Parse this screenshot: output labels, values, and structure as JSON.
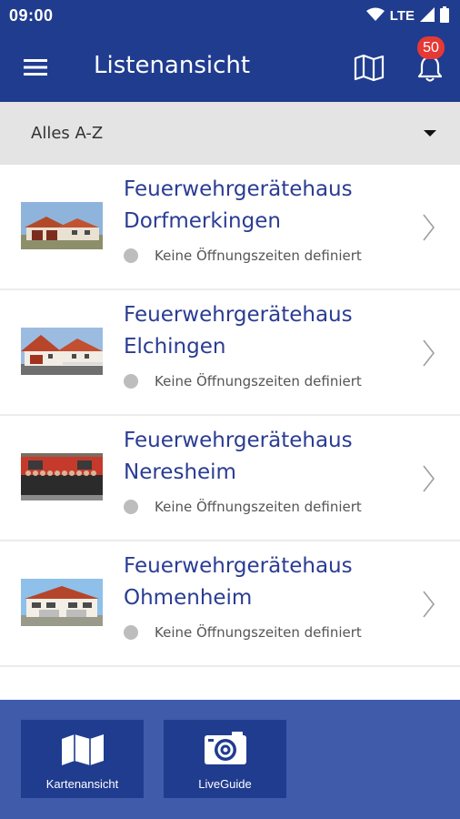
{
  "statusbar": {
    "time": "09:00",
    "network": "LTE",
    "icons": [
      "wifi-icon",
      "signal-icon",
      "battery-icon"
    ]
  },
  "appbar": {
    "title": "Listenansicht",
    "notification_count": "50",
    "icons": [
      "menu-icon",
      "map-icon",
      "bell-icon"
    ]
  },
  "sort": {
    "label": "Alles A-Z"
  },
  "list": {
    "items": [
      {
        "title_line1": "Feuerwehrgerätehaus",
        "title_line2": "Dorfmerkingen",
        "status": "Keine Öffnungszeiten definiert"
      },
      {
        "title_line1": "Feuerwehrgerätehaus",
        "title_line2": "Elchingen",
        "status": "Keine Öffnungszeiten definiert"
      },
      {
        "title_line1": "Feuerwehrgerätehaus",
        "title_line2": "Neresheim",
        "status": "Keine Öffnungszeiten definiert"
      },
      {
        "title_line1": "Feuerwehrgerätehaus",
        "title_line2": "Ohmenheim",
        "status": "Keine Öffnungszeiten definiert"
      }
    ]
  },
  "bottom": {
    "map_label": "Kartenansicht",
    "liveguide_label": "LiveGuide"
  },
  "colors": {
    "primary": "#203c8f",
    "bottom_bar": "#3f5ba9",
    "title_text": "#2a3c93",
    "badge": "#e53935",
    "status_dot": "#bdbdbd"
  }
}
